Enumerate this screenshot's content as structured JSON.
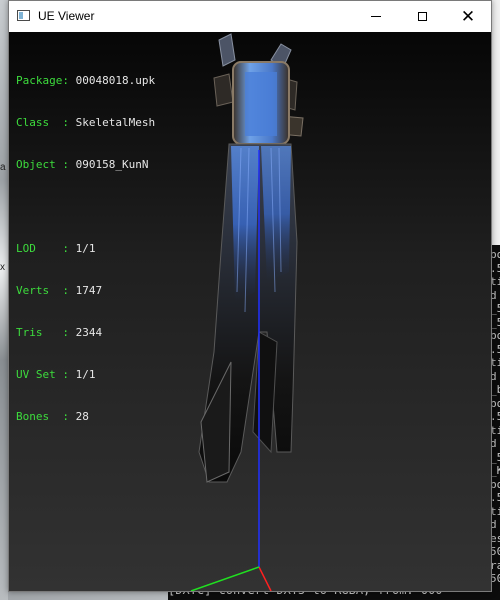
{
  "window": {
    "title": "UE Viewer",
    "controls": {
      "minimize": "minimize",
      "maximize": "maximize",
      "close": "close"
    }
  },
  "info": {
    "package_label": "Package: ",
    "package_value": "00048018.upk",
    "class_label": "Class  : ",
    "class_value": "SkeletalMesh",
    "object_label": "Object : ",
    "object_value": "090158_KunN",
    "lod_label": "LOD    : ",
    "lod_value": "1/1",
    "verts_label": "Verts  : ",
    "verts_value": "1747",
    "tris_label": "Tris   : ",
    "tris_value": "2344",
    "uvset_label": "UV Set : ",
    "uvset_value": "1/1",
    "bones_label": "Bones  : ",
    "bones_value": "28"
  },
  "background_console": {
    "bottom_line": "[DXTC] convert DXT5 to RGBA, from: 000",
    "right_column": [
      "bo",
      ".5",
      "ti",
      "d",
      "_5",
      "_5",
      "bo",
      ".5",
      "ti",
      "d",
      "_b",
      "bo",
      ".5",
      "ti",
      "d",
      "_5",
      "_K",
      "bo",
      ".5",
      "ti",
      "d",
      "es",
      "50",
      "ra",
      "50"
    ]
  },
  "colors": {
    "info_label": "#3ddc3d",
    "info_value": "#e6e6e6",
    "axis_x": "#ff2020",
    "axis_y": "#20e020",
    "axis_z": "#2030ff"
  }
}
